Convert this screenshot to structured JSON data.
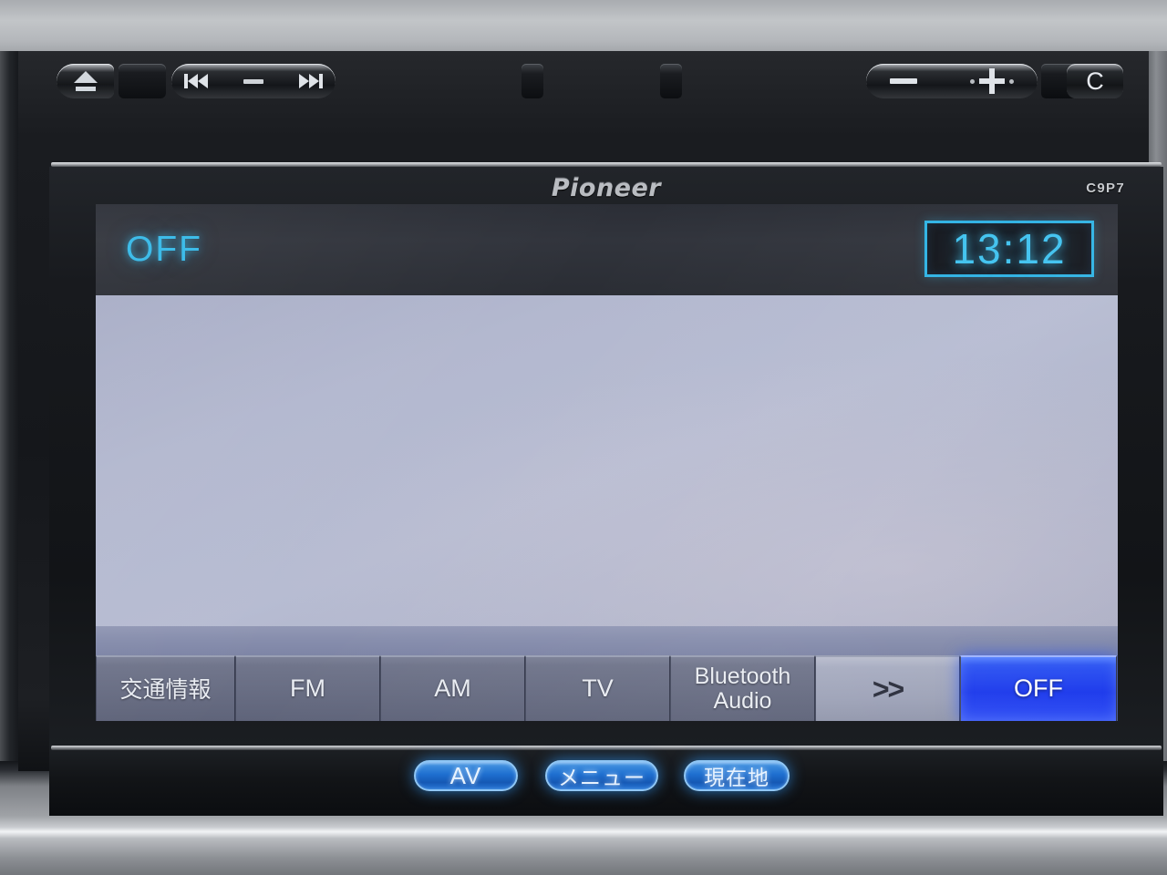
{
  "device": {
    "brand_logo": "Pioneer",
    "model_code": "C9P7"
  },
  "screen": {
    "status_bar": {
      "source_label": "OFF",
      "clock": "13:12",
      "clock_color": "#3fc2ef",
      "source_color": "#35b9e8"
    },
    "content_panel": {
      "text": "",
      "background_color": "#b3b8cf"
    },
    "source_buttons": [
      {
        "label": "交通情報",
        "name": "traffic-info",
        "state": "normal"
      },
      {
        "label": "FM",
        "name": "fm",
        "state": "normal"
      },
      {
        "label": "AM",
        "name": "am",
        "state": "normal"
      },
      {
        "label": "TV",
        "name": "tv",
        "state": "normal"
      },
      {
        "label_line1": "Bluetooth",
        "label_line2": "Audio",
        "name": "bluetooth-audio",
        "state": "normal"
      },
      {
        "label": ">>",
        "name": "next-page",
        "state": "highlighted"
      },
      {
        "label": "OFF",
        "name": "off",
        "state": "active",
        "active_color": "#2f56f2"
      }
    ]
  },
  "hardware_buttons": {
    "eject": {
      "icon": "eject-icon",
      "label": ""
    },
    "track": {
      "prev_icon": "previous-track-icon",
      "next_icon": "next-track-icon",
      "separator": "—"
    },
    "av": {
      "label": "AV"
    },
    "menu": {
      "label": "メニュー"
    },
    "current_location": {
      "label": "現在地"
    },
    "volume": {
      "minus_label": "−",
      "plus_label": "+"
    },
    "c_button": {
      "label": "C"
    },
    "illuminated_color": "#1e6fd0"
  }
}
